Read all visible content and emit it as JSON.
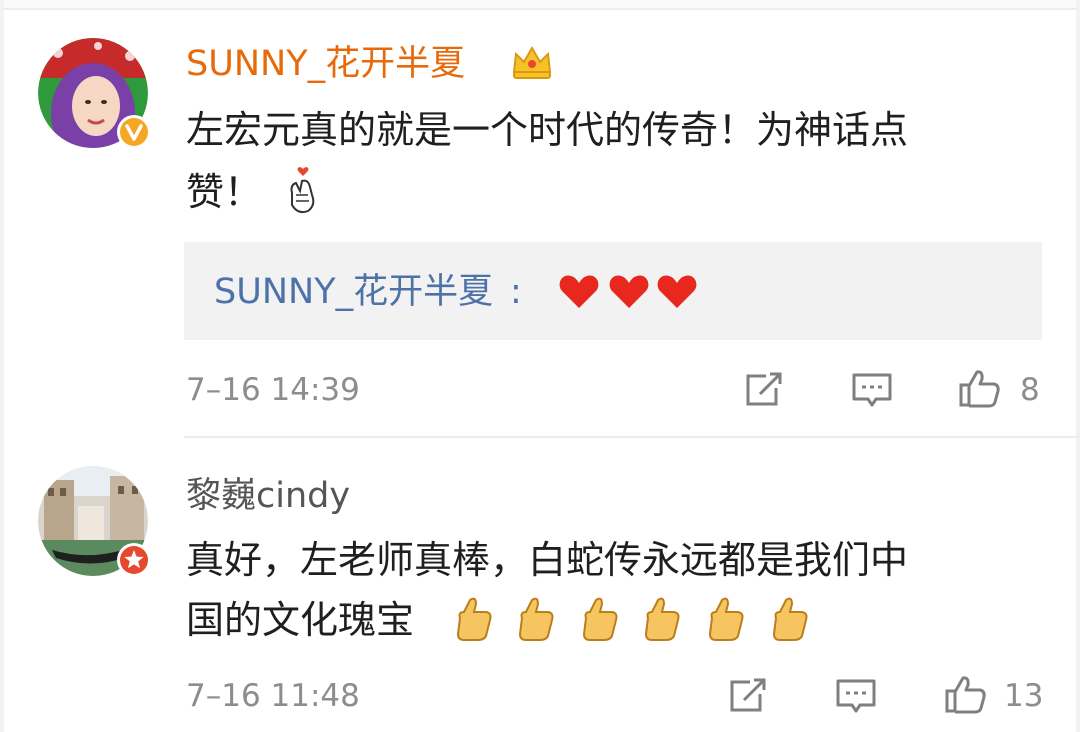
{
  "comments": [
    {
      "username": "SUNNY_花开半夏",
      "badge": "verified-v-badge",
      "crown": "crown-icon",
      "text_line1": "左宏元真的就是一个时代的传奇！为神话点",
      "text_line2": "赞！",
      "inline_emoji": "finger-heart-emoji",
      "reply": {
        "user": "SUNNY_花开半夏",
        "sep": ":",
        "emoji": [
          "heart-emoji",
          "heart-emoji",
          "heart-emoji"
        ]
      },
      "time": "7–16 14:39",
      "actions": {
        "share_icon": "share-edit-icon",
        "comment_icon": "comment-bubble-icon",
        "like_icon": "thumbs-up-icon",
        "like_count": "8"
      }
    },
    {
      "username": "黎巍cindy",
      "badge": "star-badge",
      "text_line1": "真好，左老师真棒，白蛇传永远都是我们中",
      "text_line2": "国的文化瑰宝",
      "inline_emoji": "thumbs-up-emoji",
      "time": "7–16 11:48",
      "actions": {
        "share_icon": "share-edit-icon",
        "comment_icon": "comment-bubble-icon",
        "like_icon": "thumbs-up-icon",
        "like_count": "13"
      }
    }
  ],
  "colors": {
    "username_orange": "#e8690a",
    "reply_blue": "#4d72a8",
    "meta_gray": "#8d8d8d",
    "reply_bg": "#f2f2f2",
    "verified_yellow": "#f5a623",
    "star_red": "#e64a2e"
  }
}
